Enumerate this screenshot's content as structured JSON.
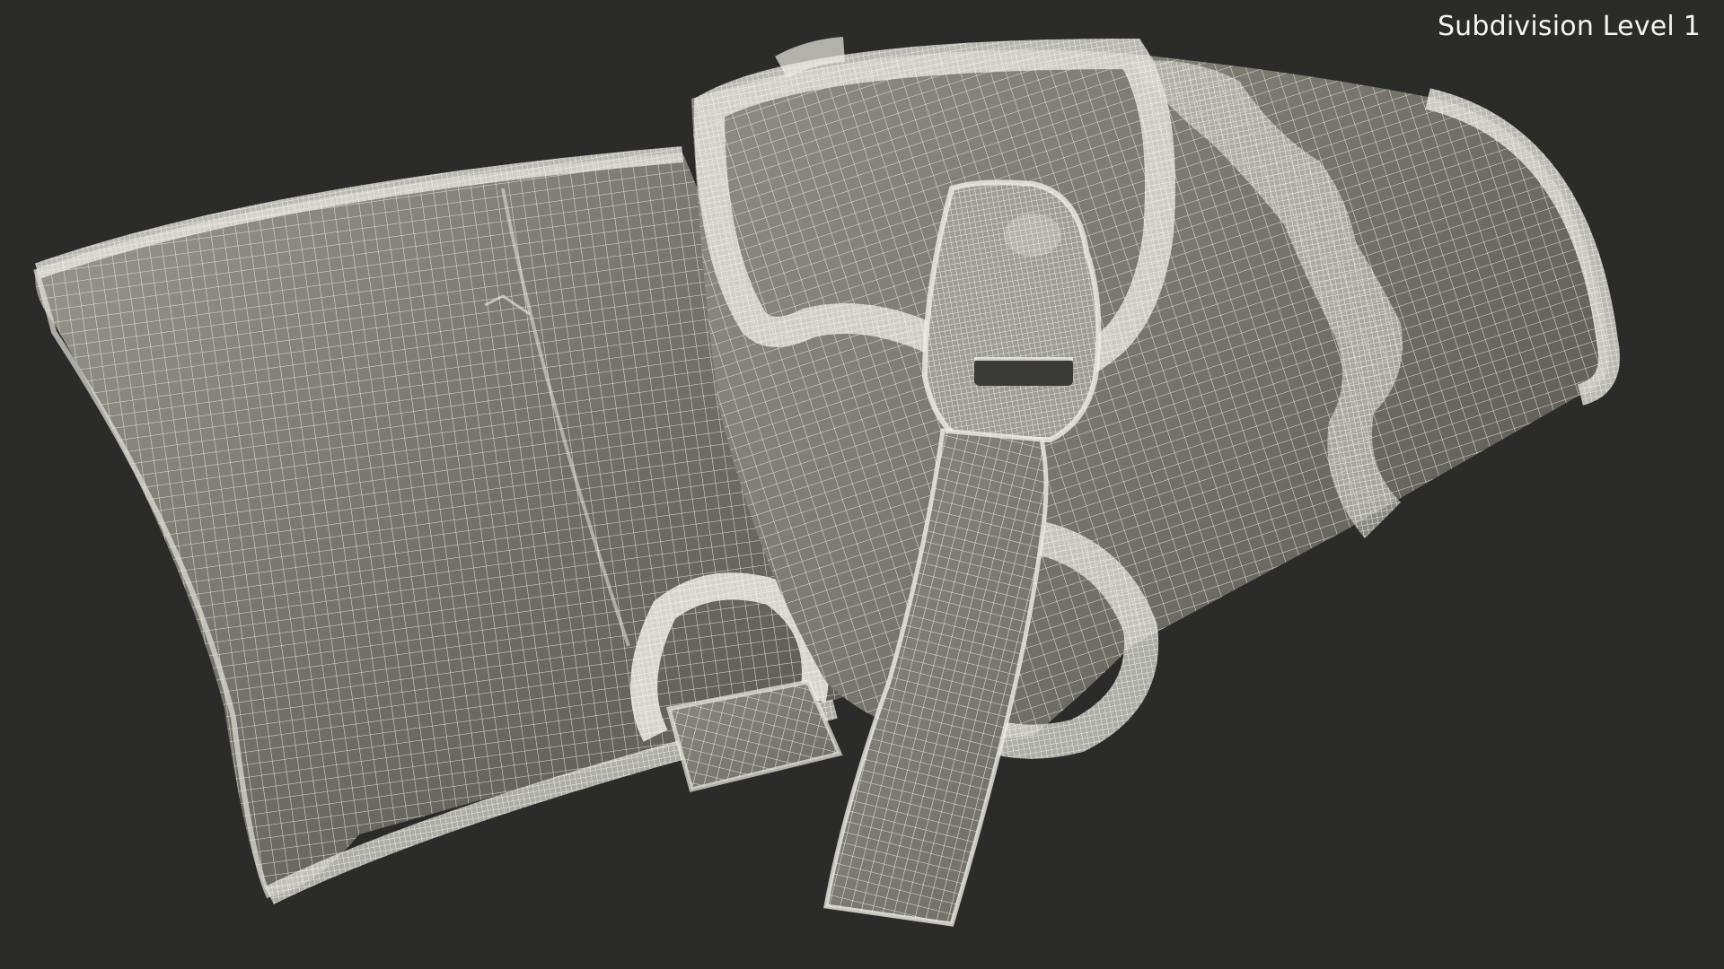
{
  "viewport": {
    "background_color": "#2b2b2a",
    "label": "Subdivision Level 1"
  },
  "model": {
    "wire_color": "#f2f1ea",
    "surface_dark": "#5e5d55",
    "surface_light": "#9c9b93"
  }
}
